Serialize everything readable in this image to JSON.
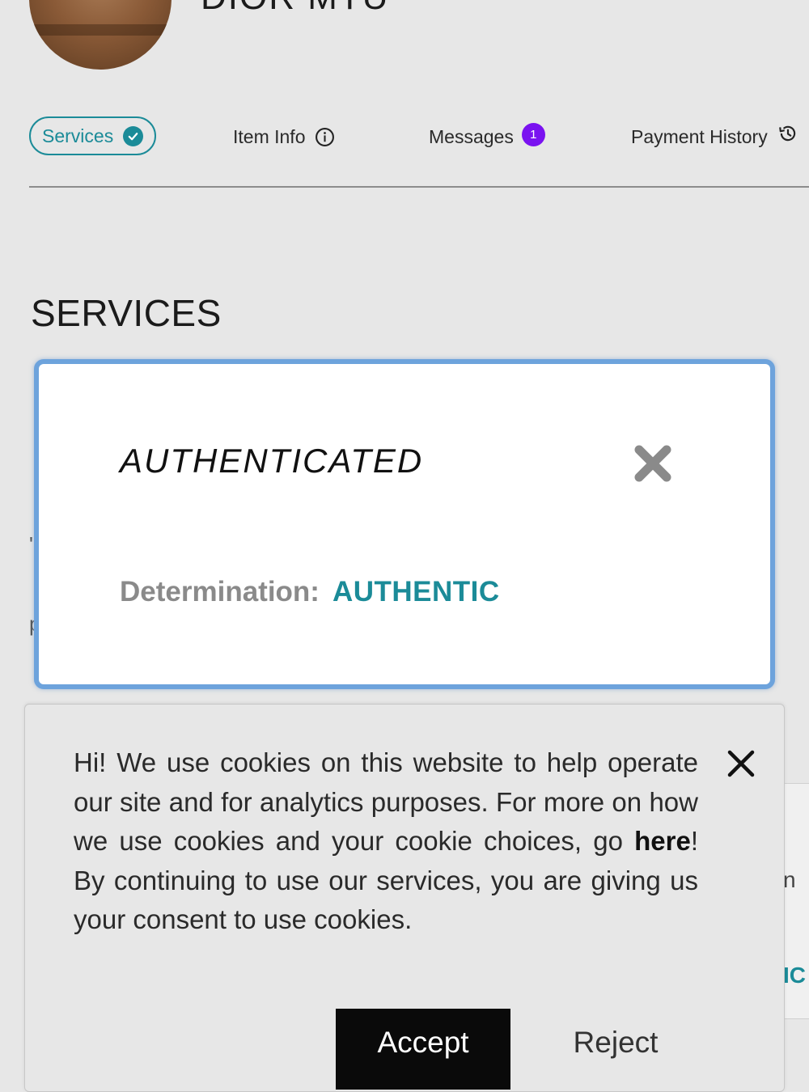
{
  "header": {
    "title": "DIOR MTU"
  },
  "tabs": [
    {
      "label": "Services",
      "icon": "check-circle-icon",
      "active": true
    },
    {
      "label": "Item Info",
      "icon": "info-icon"
    },
    {
      "label": "Messages",
      "badge": "1"
    },
    {
      "label": "Payment History",
      "icon": "history-icon"
    }
  ],
  "section": {
    "title": "SERVICES",
    "peek_texts": [
      "'e",
      "p",
      "n",
      "IC"
    ]
  },
  "modal": {
    "title": "AUTHENTICATED",
    "determination_label": "Determination:",
    "determination_value": "AUTHENTIC"
  },
  "cookie_banner": {
    "text_before": "Hi! We use cookies on this website to help operate our site and for analytics purposes. For more on how we use cookies and your cookie choices, go ",
    "link_text": "here",
    "text_after": "! By continuing to use our services, you are giving us your consent to use cookies.",
    "accept_label": "Accept",
    "reject_label": "Reject"
  },
  "colors": {
    "accent": "#1b8b98",
    "badge": "#7a12f0",
    "modal_border": "#6da3dc",
    "background": "#e7e7e7"
  }
}
